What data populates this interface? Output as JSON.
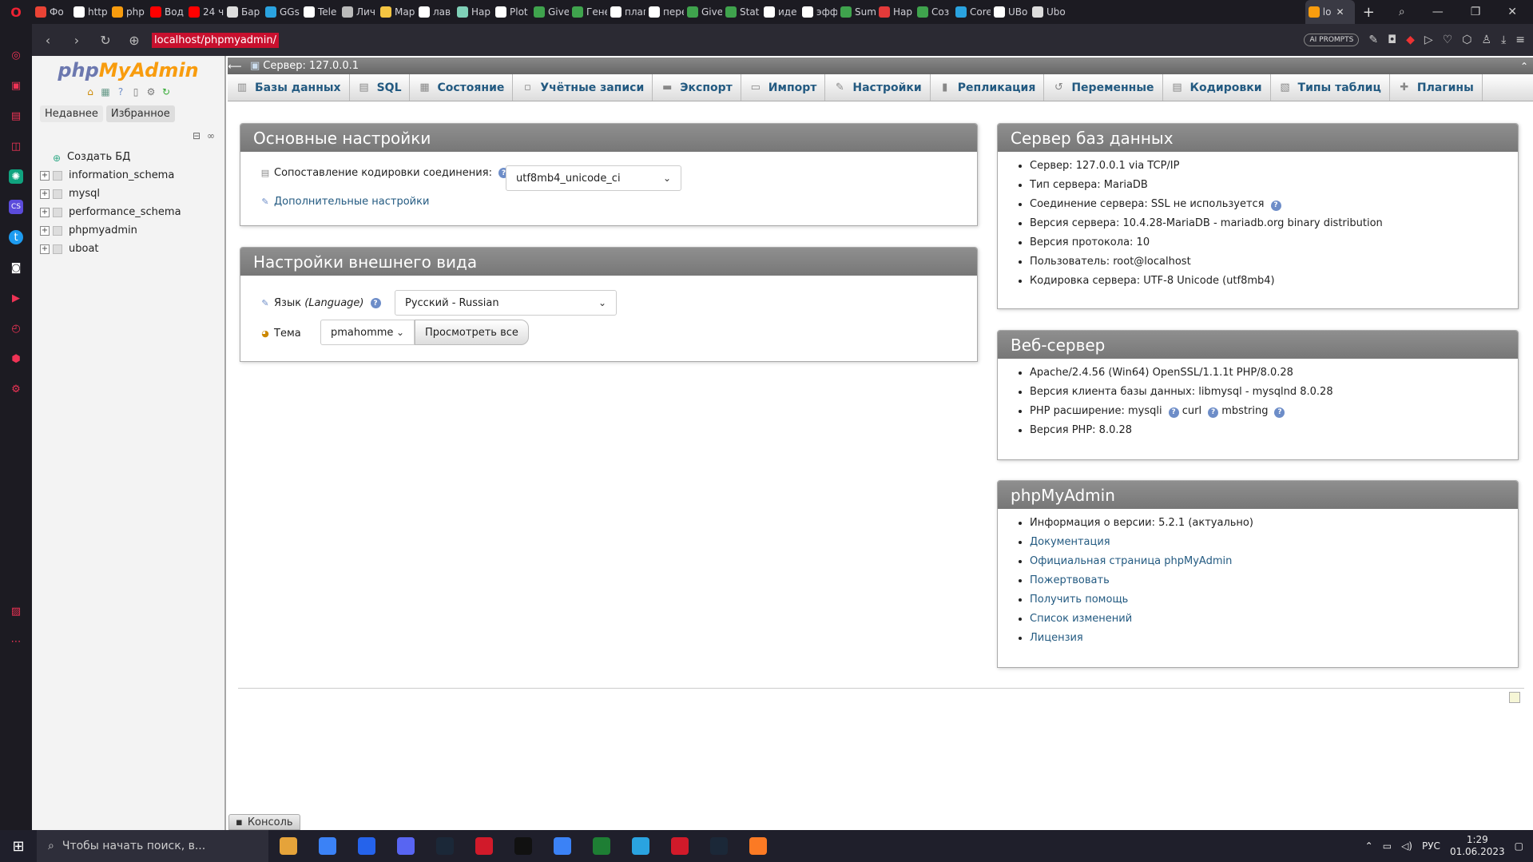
{
  "browser": {
    "tabs": [
      {
        "label": "Фо",
        "color": "#ea4335"
      },
      {
        "label": "http",
        "color": "#ffffff"
      },
      {
        "label": "php",
        "color": "#f89c0e"
      },
      {
        "label": "Вод",
        "color": "#ff0000"
      },
      {
        "label": "24 ч",
        "color": "#ff0000"
      },
      {
        "label": "Бар",
        "color": "#dddddd"
      },
      {
        "label": "GGs",
        "color": "#2aa3e0"
      },
      {
        "label": "Tele",
        "color": "#ffffff"
      },
      {
        "label": "Лич",
        "color": "#bbbbbb"
      },
      {
        "label": "Мар",
        "color": "#f5c542"
      },
      {
        "label": "лав",
        "color": "#ffffff"
      },
      {
        "label": "Нар",
        "color": "#7fd0b8"
      },
      {
        "label": "Plot",
        "color": "#ffffff"
      },
      {
        "label": "Give",
        "color": "#3fa34d"
      },
      {
        "label": "Гене",
        "color": "#3fa34d"
      },
      {
        "label": "плаг",
        "color": "#ffffff"
      },
      {
        "label": "пере",
        "color": "#ffffff"
      },
      {
        "label": "Give",
        "color": "#3fa34d"
      },
      {
        "label": "Stat",
        "color": "#3fa34d"
      },
      {
        "label": "иде",
        "color": "#ffffff"
      },
      {
        "label": "эфф",
        "color": "#ffffff"
      },
      {
        "label": "Sum",
        "color": "#3fa34d"
      },
      {
        "label": "Нар",
        "color": "#e33a3a"
      },
      {
        "label": "Соз",
        "color": "#3fa34d"
      },
      {
        "label": "Core",
        "color": "#2aa3e0"
      },
      {
        "label": "UBo",
        "color": "#ffffff"
      },
      {
        "label": "Ubo",
        "color": "#dddddd"
      }
    ],
    "active_tab_label": "lo",
    "url": "localhost/phpmyadmin/",
    "ai_badge": "AI PROMPTS"
  },
  "pma_nav": {
    "logo_php": "php",
    "logo_my": "MyAdmin",
    "recent": "Недавнее",
    "favorites": "Избранное",
    "create_db": "Создать БД",
    "databases": [
      {
        "name": "information_schema"
      },
      {
        "name": "mysql"
      },
      {
        "name": "performance_schema"
      },
      {
        "name": "phpmyadmin"
      },
      {
        "name": "uboat"
      }
    ]
  },
  "server_bar": {
    "title": "Сервер: 127.0.0.1"
  },
  "menu": [
    {
      "label": "Базы данных",
      "icon": "db-icon"
    },
    {
      "label": "SQL",
      "icon": "sql-icon"
    },
    {
      "label": "Состояние",
      "icon": "status-icon"
    },
    {
      "label": "Учётные записи",
      "icon": "users-icon"
    },
    {
      "label": "Экспорт",
      "icon": "export-icon"
    },
    {
      "label": "Импорт",
      "icon": "import-icon"
    },
    {
      "label": "Настройки",
      "icon": "wrench-icon"
    },
    {
      "label": "Репликация",
      "icon": "replication-icon"
    },
    {
      "label": "Переменные",
      "icon": "variables-icon"
    },
    {
      "label": "Кодировки",
      "icon": "charset-icon"
    },
    {
      "label": "Типы таблиц",
      "icon": "engines-icon"
    },
    {
      "label": "Плагины",
      "icon": "plugin-icon"
    }
  ],
  "general": {
    "title": "Основные настройки",
    "collation_label": "Сопоставление кодировки соединения:",
    "collation_value": "utf8mb4_unicode_ci",
    "more_settings": "Дополнительные настройки"
  },
  "appearance": {
    "title": "Настройки внешнего вида",
    "language_label": "Язык",
    "language_sub": "(Language)",
    "language_value": "Русский - Russian",
    "theme_label": "Тема",
    "theme_value": "pmahomme",
    "view_all": "Просмотреть все"
  },
  "db_server": {
    "title": "Сервер баз данных",
    "items": [
      "Сервер: 127.0.0.1 via TCP/IP",
      "Тип сервера: MariaDB",
      "Соединение сервера: SSL не используется",
      "Версия сервера: 10.4.28-MariaDB - mariadb.org binary distribution",
      "Версия протокола: 10",
      "Пользователь: root@localhost",
      "Кодировка сервера: UTF-8 Unicode (utf8mb4)"
    ]
  },
  "web_server": {
    "title": "Веб-сервер",
    "items": [
      "Apache/2.4.56 (Win64) OpenSSL/1.1.1t PHP/8.0.28",
      "Версия клиента базы данных: libmysql - mysqlnd 8.0.28"
    ],
    "php_ext_label": "PHP расширение: mysqli",
    "php_ext_curl": "curl",
    "php_ext_mbstring": "mbstring",
    "php_version": "Версия PHP: 8.0.28"
  },
  "pma_info": {
    "title": "phpMyAdmin",
    "version": "Информация о версии: 5.2.1 (актуально)",
    "links": [
      "Документация",
      "Официальная страница phpMyAdmin",
      "Пожертвовать",
      "Получить помощь",
      "Список изменений",
      "Лицензия"
    ]
  },
  "console": "Консоль",
  "taskbar": {
    "search_placeholder": "Чтобы начать поиск, в...",
    "apps": [
      "#e5a33a",
      "#3b82f6",
      "#2563eb",
      "#5865f2",
      "#1b2838",
      "#d11a2a",
      "#111111",
      "#3b82f6",
      "#1e7e34",
      "#2aa3e0",
      "#d11a2a",
      "#1b2838",
      "#fb7a24"
    ],
    "lang": "РУС",
    "time": "1:29",
    "date": "01.06.2023"
  }
}
